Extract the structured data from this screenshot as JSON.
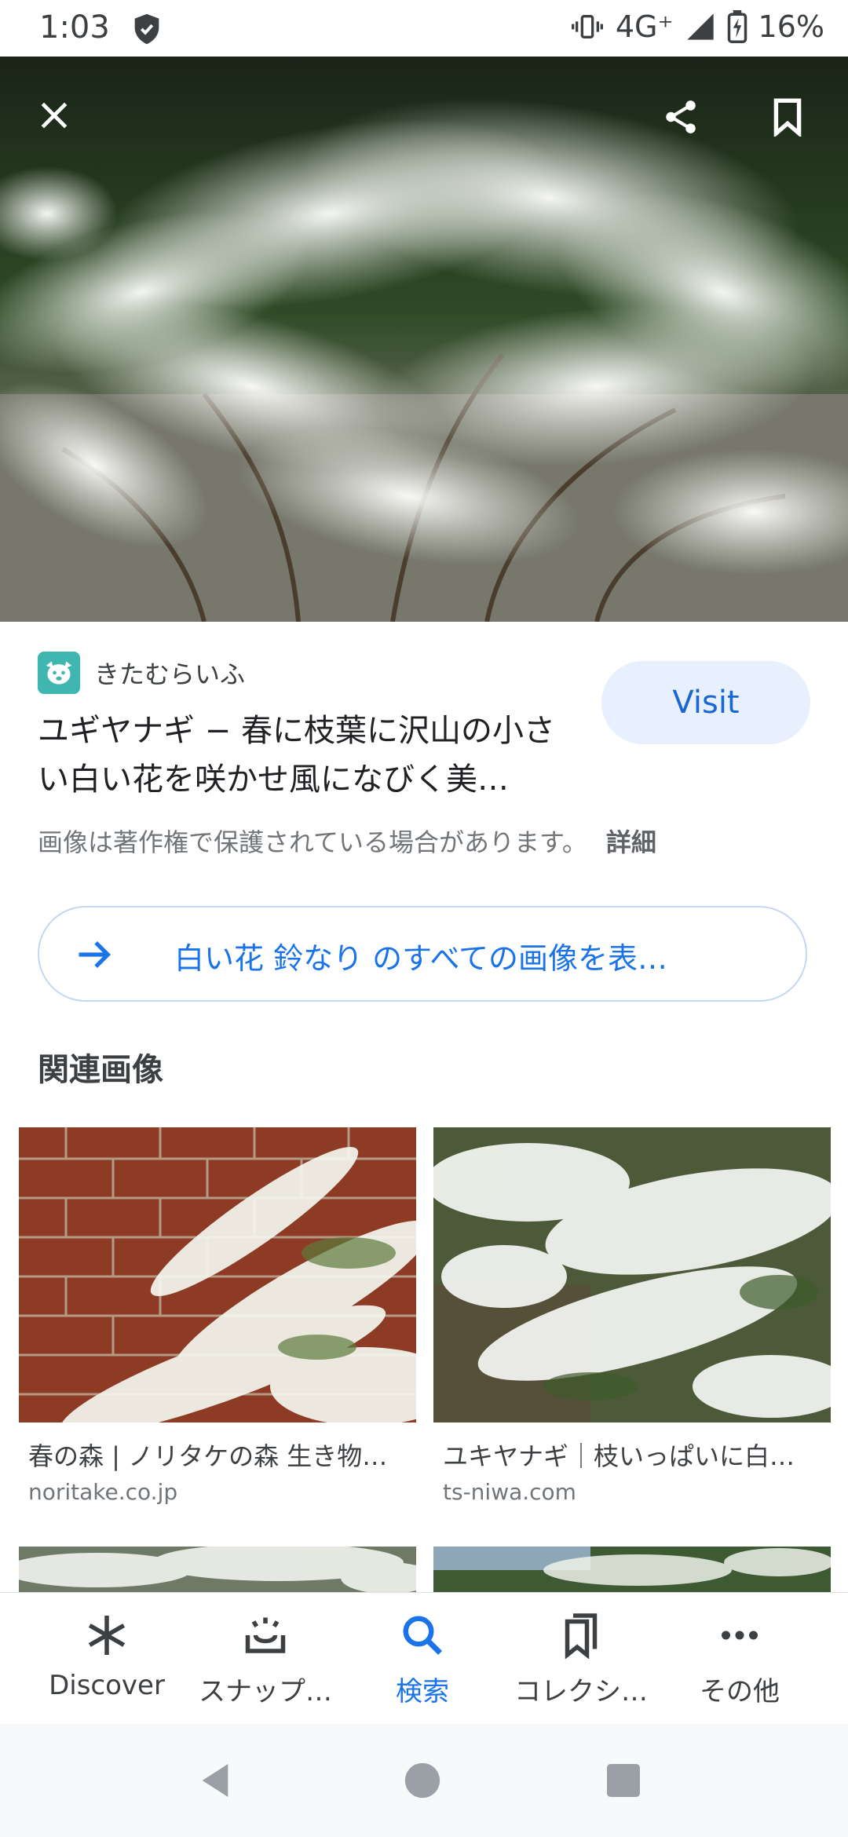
{
  "status_bar": {
    "time": "1:03",
    "network": "4G⁺",
    "battery": "16%",
    "icons": [
      "shield-icon",
      "vibrate-icon",
      "signal-icon",
      "battery-icon"
    ]
  },
  "hero": {
    "close_icon": "close-icon",
    "share_icon": "share-icon",
    "save_icon": "bookmark-icon"
  },
  "result": {
    "source_name": "きたむらいふ",
    "title": "ユギヤナギ − 春に枝葉に沢山の小さい白い花を咲かせ風になびく美…",
    "visit_label": "Visit",
    "copyright_notice": "画像は著作権で保護されている場合があります。",
    "details_label": "詳細"
  },
  "all_images": {
    "label": "白い花 鈴なり のすべての画像を表…"
  },
  "related": {
    "heading": "関連画像",
    "items": [
      {
        "caption": "春の森 | ノリタケの森 生き物…",
        "domain": "noritake.co.jp"
      },
      {
        "caption": "ユキヤナギ｜枝いっぱいに白…",
        "domain": "ts-niwa.com"
      }
    ]
  },
  "bottom_nav": {
    "items": [
      {
        "label": "Discover",
        "icon": "asterisk-icon"
      },
      {
        "label": "スナップ…",
        "icon": "snapshot-icon"
      },
      {
        "label": "検索",
        "icon": "search-icon",
        "active": true
      },
      {
        "label": "コレクシ…",
        "icon": "collections-icon"
      },
      {
        "label": "その他",
        "icon": "more-icon"
      }
    ]
  },
  "colors": {
    "accent": "#1a73e8",
    "visit_bg": "#e8f0fe",
    "text_primary": "#202124",
    "text_secondary": "#70757a"
  }
}
